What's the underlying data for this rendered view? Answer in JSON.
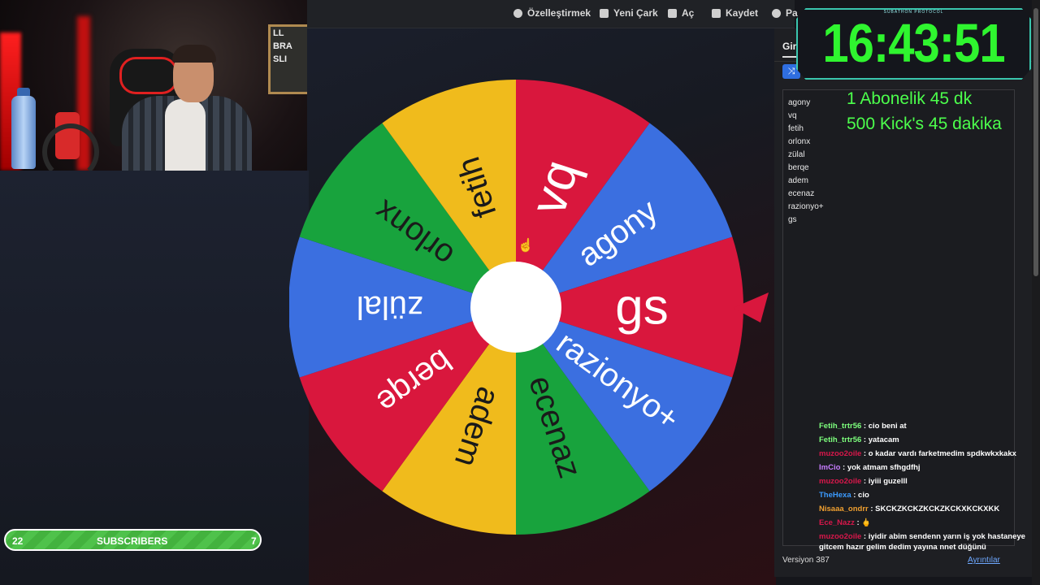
{
  "toolbar": {
    "items": [
      {
        "label": "Özelleştirmek",
        "icon": "palette-icon"
      },
      {
        "label": "Yeni Çark",
        "icon": "new-file-icon"
      },
      {
        "label": "Aç",
        "icon": "folder-open-icon"
      },
      {
        "label": "Kaydet",
        "icon": "save-icon"
      },
      {
        "label": "Pa",
        "icon": "share-icon"
      }
    ]
  },
  "wheel": {
    "segments": [
      {
        "label": "vq",
        "color": "#d9173d"
      },
      {
        "label": "agony",
        "color": "#3b6fe0"
      },
      {
        "label": "gs",
        "color": "#d9173d"
      },
      {
        "label": "razionyo+",
        "color": "#3b6fe0"
      },
      {
        "label": "ecenaz",
        "color": "#18a33d"
      },
      {
        "label": "adem",
        "color": "#f0bb1c"
      },
      {
        "label": "berqe",
        "color": "#d9173d"
      },
      {
        "label": "zülal",
        "color": "#3b6fe0"
      },
      {
        "label": "orlonx",
        "color": "#18a33d"
      },
      {
        "label": "fetih",
        "color": "#f0bb1c"
      }
    ],
    "pointer_color": "#d9173d",
    "hub_color": "#ffffff"
  },
  "panel": {
    "tab_label": "Gir",
    "entries": [
      "agony",
      "vq",
      "fetih",
      "orlonx",
      "zülal",
      "berqe",
      "adem",
      "ecenaz",
      "razionyo+",
      "gs"
    ],
    "version": "Versiyon 387",
    "details_link": "Ayrıntılar"
  },
  "overlay": {
    "timer_label": "SUBATHON PROTOCOL",
    "timer": "16:43:51",
    "rule_1": "1 Abonelik 45 dk",
    "rule_2": "500 Kick's 45 dakika"
  },
  "subs_bar": {
    "left_count": "22",
    "label": "SUBSCRIBERS",
    "right_count": "7"
  },
  "webcam": {
    "board_text": [
      "LL",
      "BRA",
      "SLI"
    ]
  },
  "chat": {
    "messages": [
      {
        "user": "Fetih_trtr56",
        "user_color": "#7dff7d",
        "text": ": cio beni at"
      },
      {
        "user": "Fetih_trtr56",
        "user_color": "#7dff7d",
        "text": ": yatacam"
      },
      {
        "user": "muzoo2oile",
        "user_color": "#d9174b",
        "text": ": o kadar vardı farketmedim spdkwkxkakx"
      },
      {
        "user": "ImCio",
        "user_color": "#c77dff",
        "text": ": yok atmam sfhgdfhj"
      },
      {
        "user": "muzoo2oile",
        "user_color": "#d9174b",
        "text": ": iyiii guzelll"
      },
      {
        "user": "TheHexa",
        "user_color": "#3b9bff",
        "text": ": cio"
      },
      {
        "user": "Nisaaa_ondrr",
        "user_color": "#f0a030",
        "text": ": SKCKZKCKZKCKZKCKXKCKXKK"
      },
      {
        "user": "Ece_Nazz",
        "user_color": "#d9174b",
        "text": ": 🖕"
      },
      {
        "user": "muzoo2oile",
        "user_color": "#d9174b",
        "text": ": iyidir abim sendenn yarın iş yok hastaneye gitcem hazır gelim dedim yayına nnet düğünü"
      }
    ]
  }
}
